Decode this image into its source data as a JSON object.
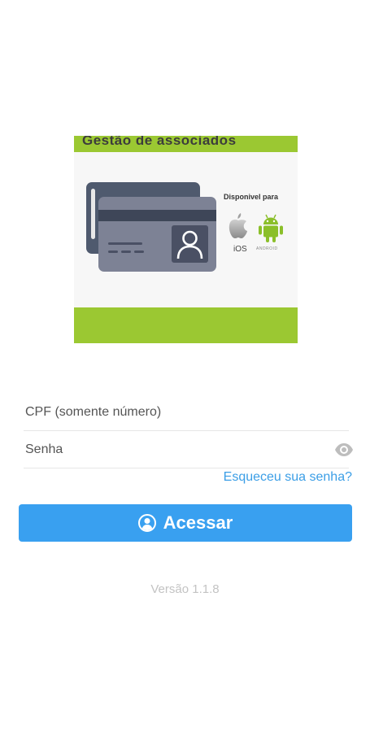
{
  "banner": {
    "title": "Gestão de associados",
    "platform_label": "Disponivel para",
    "ios_label": "iOS",
    "android_label": "ANDROID",
    "icons": [
      "id-card-icon",
      "apple-icon",
      "android-icon"
    ],
    "colors": {
      "accent_green": "#9bc832",
      "card_dark": "#4f5a6e",
      "card_light": "#7d8295"
    }
  },
  "form": {
    "cpf_placeholder": "CPF (somente número)",
    "password_placeholder": "Senha",
    "show_password_icon": "eye-icon",
    "forgot_password": "Esqueceu sua senha?"
  },
  "login_button": {
    "label": "Acessar",
    "icon": "user-circle-icon",
    "color": "#39a0f0"
  },
  "footer": {
    "version": "Versão 1.1.8"
  }
}
